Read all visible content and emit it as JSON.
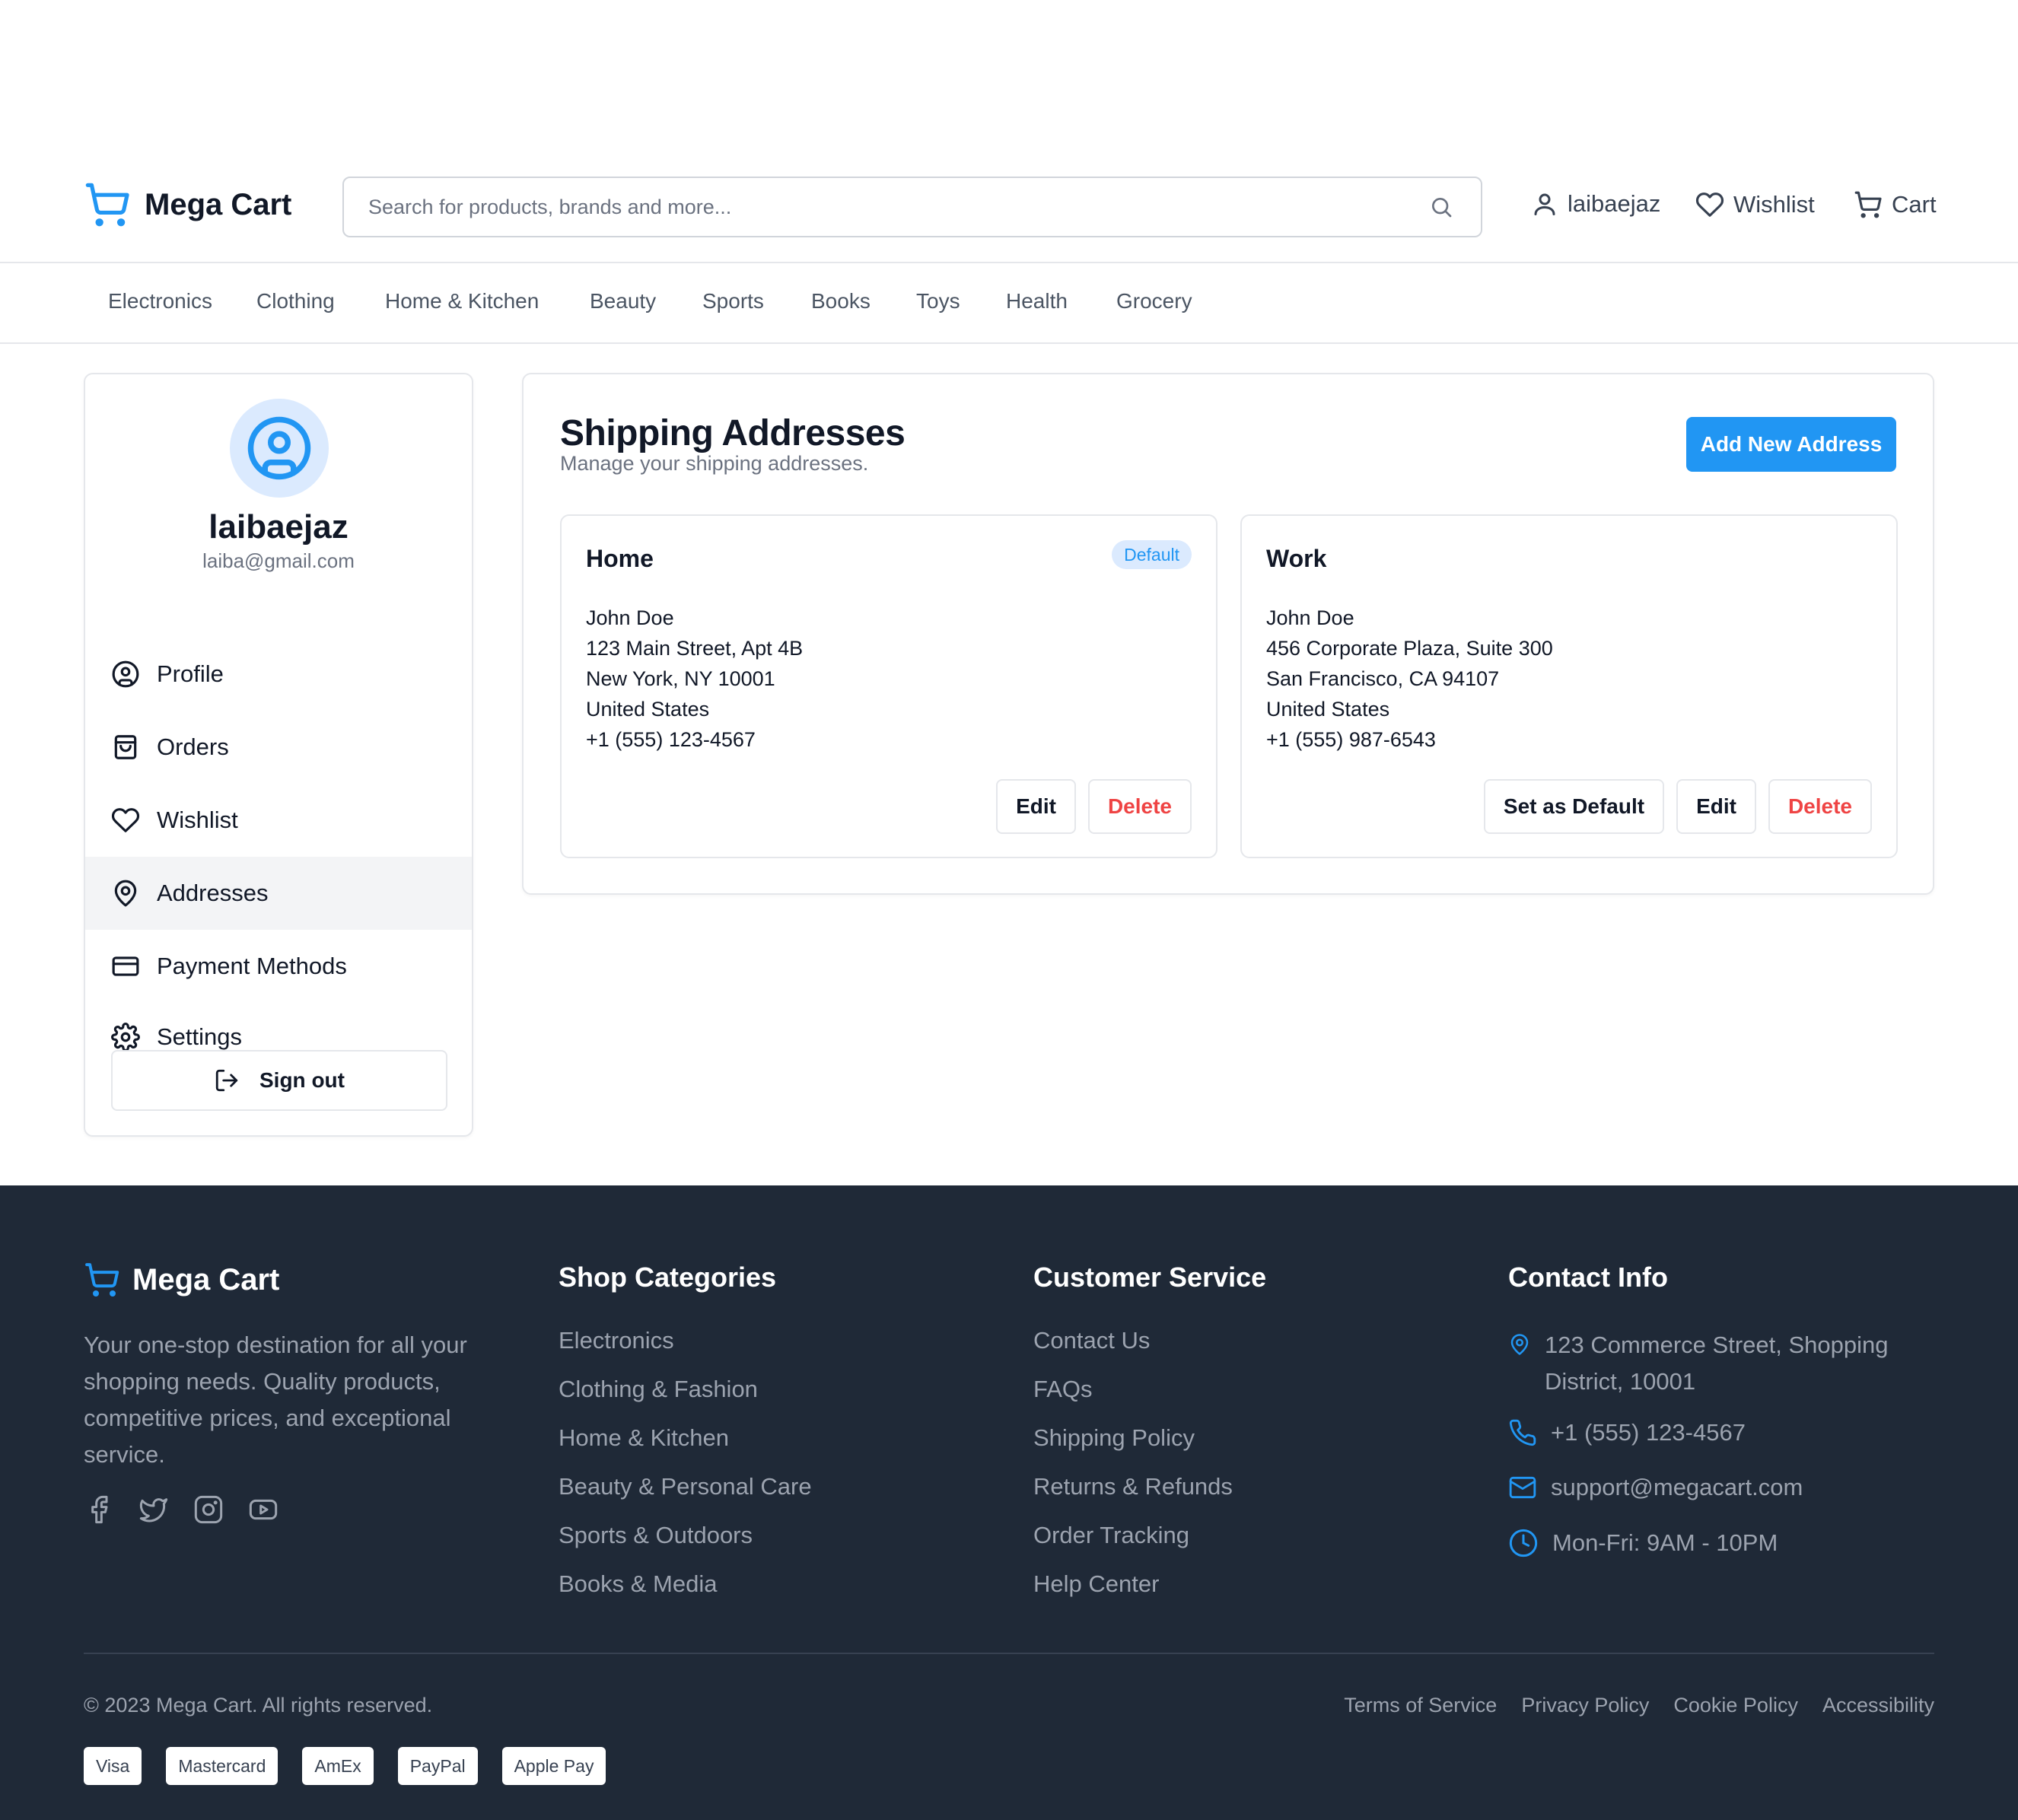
{
  "header": {
    "brand": "Mega Cart",
    "search_placeholder": "Search for products, brands and more...",
    "user_label": "laibaejaz",
    "wishlist_label": "Wishlist",
    "cart_label": "Cart",
    "accent_color": "#2196f3"
  },
  "categories": [
    "Electronics",
    "Clothing",
    "Home & Kitchen",
    "Beauty",
    "Sports",
    "Books",
    "Toys",
    "Health",
    "Grocery"
  ],
  "sidebar": {
    "username": "laibaejaz",
    "email": "laiba@gmail.com",
    "items": [
      {
        "label": "Profile",
        "icon": "user-circle-icon"
      },
      {
        "label": "Orders",
        "icon": "shopping-bag-icon"
      },
      {
        "label": "Wishlist",
        "icon": "heart-icon"
      },
      {
        "label": "Addresses",
        "icon": "map-pin-icon",
        "active": true
      },
      {
        "label": "Payment Methods",
        "icon": "credit-card-icon"
      },
      {
        "label": "Settings",
        "icon": "gear-icon"
      }
    ],
    "signout_label": "Sign out"
  },
  "main": {
    "title": "Shipping Addresses",
    "subtitle": "Manage your shipping addresses.",
    "add_button": "Add New Address",
    "addresses": [
      {
        "label": "Home",
        "badge": "Default",
        "name": "John Doe",
        "line1": "123 Main Street, Apt 4B",
        "city": "New York, NY 10001",
        "country": "United States",
        "phone": "+1 (555) 123-4567",
        "edit": "Edit",
        "delete": "Delete"
      },
      {
        "label": "Work",
        "name": "John Doe",
        "line1": "456 Corporate Plaza, Suite 300",
        "city": "San Francisco, CA 94107",
        "country": "United States",
        "phone": "+1 (555) 987-6543",
        "set_default": "Set as Default",
        "edit": "Edit",
        "delete": "Delete"
      }
    ]
  },
  "footer": {
    "brand": "Mega Cart",
    "description": "Your one-stop destination for all your shopping needs. Quality products, competitive prices, and exceptional service.",
    "social": [
      "facebook-icon",
      "twitter-icon",
      "instagram-icon",
      "youtube-icon"
    ],
    "shop_heading": "Shop Categories",
    "shop_links": [
      "Electronics",
      "Clothing & Fashion",
      "Home & Kitchen",
      "Beauty & Personal Care",
      "Sports & Outdoors",
      "Books & Media"
    ],
    "service_heading": "Customer Service",
    "service_links": [
      "Contact Us",
      "FAQs",
      "Shipping Policy",
      "Returns & Refunds",
      "Order Tracking",
      "Help Center"
    ],
    "contact_heading": "Contact Info",
    "address": "123 Commerce Street, Shopping District, 10001",
    "phone": "+1 (555) 123-4567",
    "email": "support@megacart.com",
    "hours": "Mon-Fri: 9AM - 10PM",
    "copyright": "© 2023 Mega Cart. All rights reserved.",
    "legal": [
      "Terms of Service",
      "Privacy Policy",
      "Cookie Policy",
      "Accessibility"
    ],
    "payments": [
      "Visa",
      "Mastercard",
      "AmEx",
      "PayPal",
      "Apple Pay"
    ],
    "background": "#1f2937"
  }
}
